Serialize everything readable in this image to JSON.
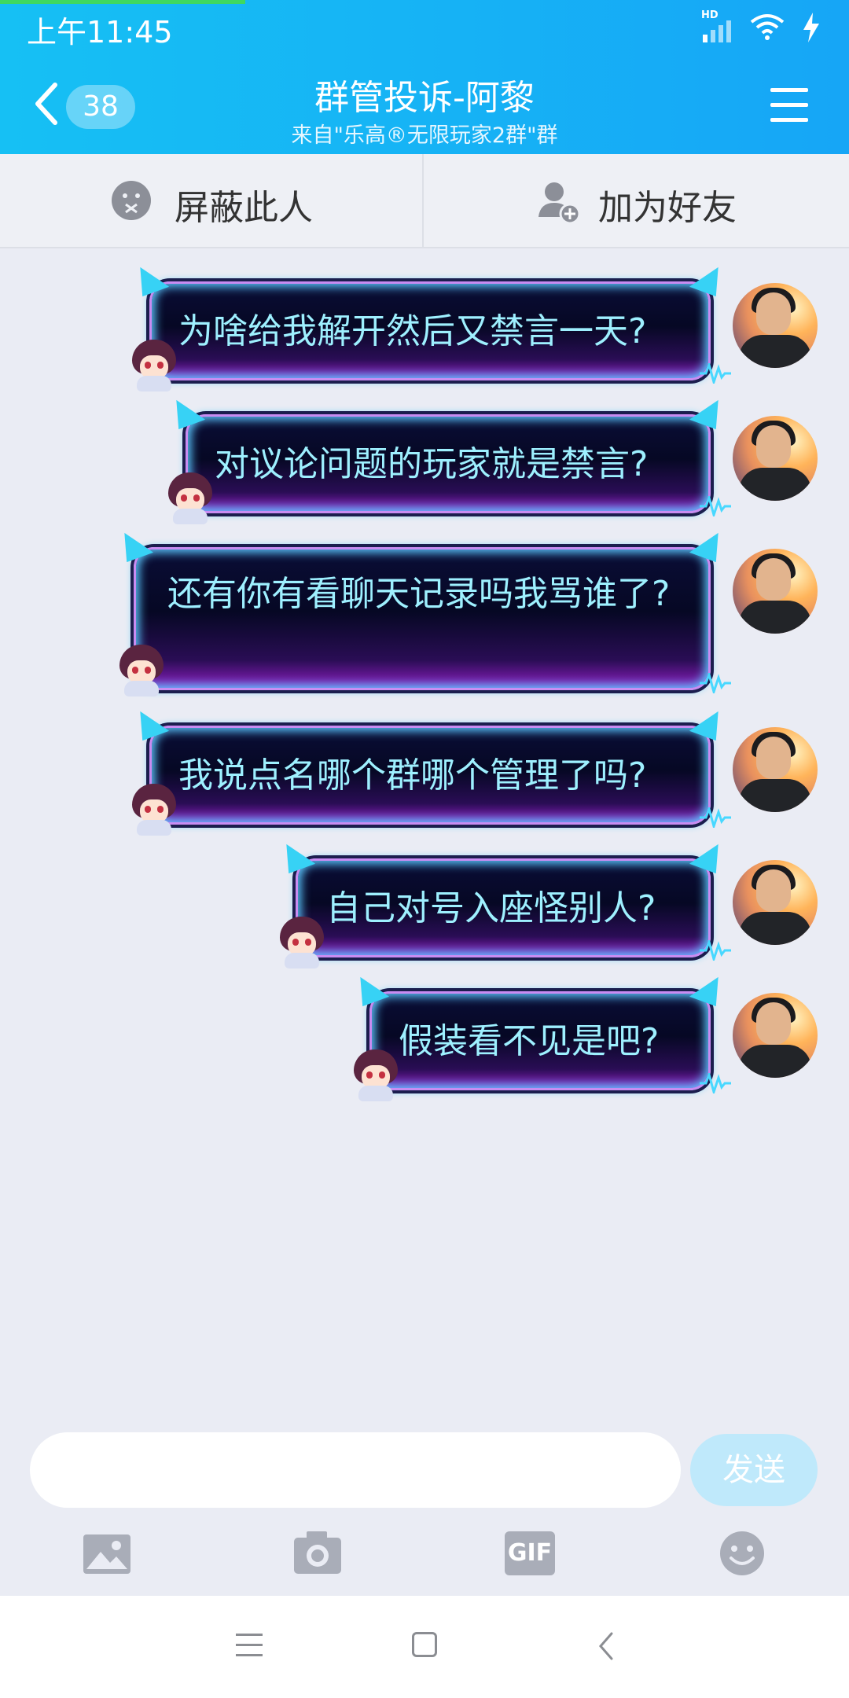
{
  "status": {
    "time": "上午11:45",
    "hd": "HD"
  },
  "header": {
    "back_badge": "38",
    "title": "群管投诉-阿黎",
    "subtitle": "来自\"乐高®无限玩家2群\"群"
  },
  "actions": {
    "block_label": "屏蔽此人",
    "add_friend_label": "加为好友"
  },
  "messages": [
    {
      "text": "为啥给我解开然后又禁言一天?"
    },
    {
      "text": "对议论问题的玩家就是禁言?"
    },
    {
      "text": "还有你有看聊天记录吗我骂谁了?"
    },
    {
      "text": "我说点名哪个群哪个管理了吗?"
    },
    {
      "text": "自己对号入座怪别人?"
    },
    {
      "text": "假装看不见是吧?"
    }
  ],
  "composer": {
    "input_value": "",
    "send_label": "发送",
    "tools": [
      "image-icon",
      "camera-icon",
      "gif-icon",
      "emoji-icon"
    ],
    "gif_label": "GIF"
  },
  "nav": [
    "menu-icon",
    "home-icon",
    "back-icon"
  ],
  "colors": {
    "header_start": "#16c0f4",
    "header_end": "#16a6f6",
    "bubble_text": "#9ef0ff",
    "send_disabled": "#bfe9fb"
  }
}
